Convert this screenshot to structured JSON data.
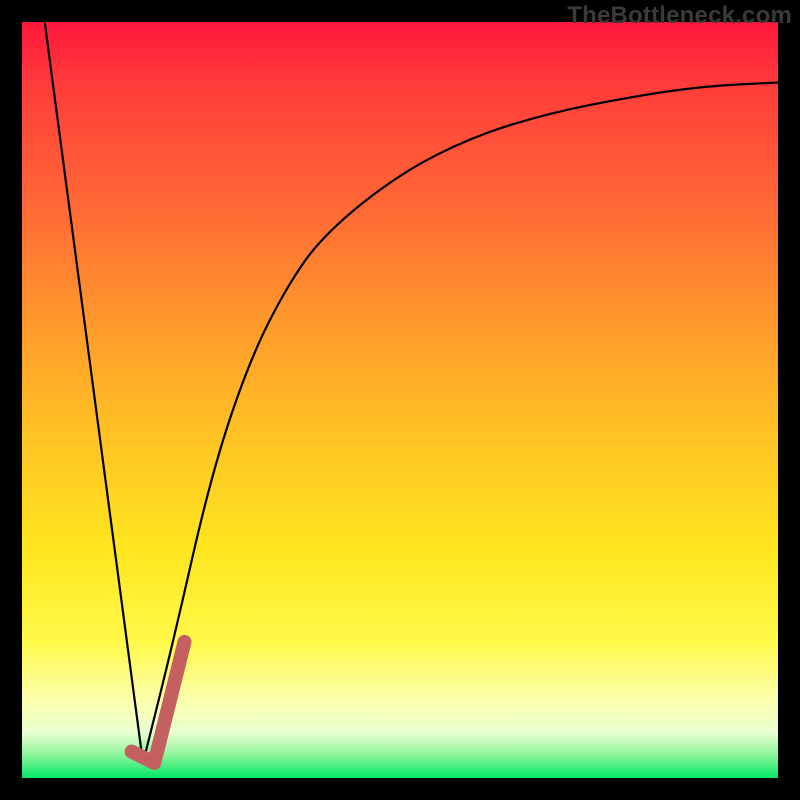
{
  "watermark": "TheBottleneck.com",
  "chart_data": {
    "type": "line",
    "title": "",
    "xlabel": "",
    "ylabel": "",
    "xlim": [
      0,
      100
    ],
    "ylim": [
      0,
      100
    ],
    "grid": false,
    "legend": false,
    "series": [
      {
        "name": "left-descent",
        "x": [
          3,
          16
        ],
        "values": [
          100,
          2
        ]
      },
      {
        "name": "right-ascent",
        "x": [
          16,
          20,
          25,
          30,
          35,
          40,
          50,
          60,
          70,
          80,
          90,
          100
        ],
        "values": [
          2,
          18,
          40,
          55,
          65,
          72,
          80,
          85,
          88,
          90,
          91.5,
          92
        ]
      }
    ],
    "annotations": [
      {
        "name": "j-marker",
        "type": "path",
        "color": "#c56060",
        "points_x": [
          14.5,
          17.5,
          21.5
        ],
        "points_y": [
          3.5,
          2,
          18
        ]
      }
    ],
    "gradient_stops": [
      {
        "pos": 0,
        "color": "#ff173d"
      },
      {
        "pos": 25,
        "color": "#ff6a35"
      },
      {
        "pos": 55,
        "color": "#ffc324"
      },
      {
        "pos": 82,
        "color": "#fff94a"
      },
      {
        "pos": 100,
        "color": "#00e765"
      }
    ]
  }
}
